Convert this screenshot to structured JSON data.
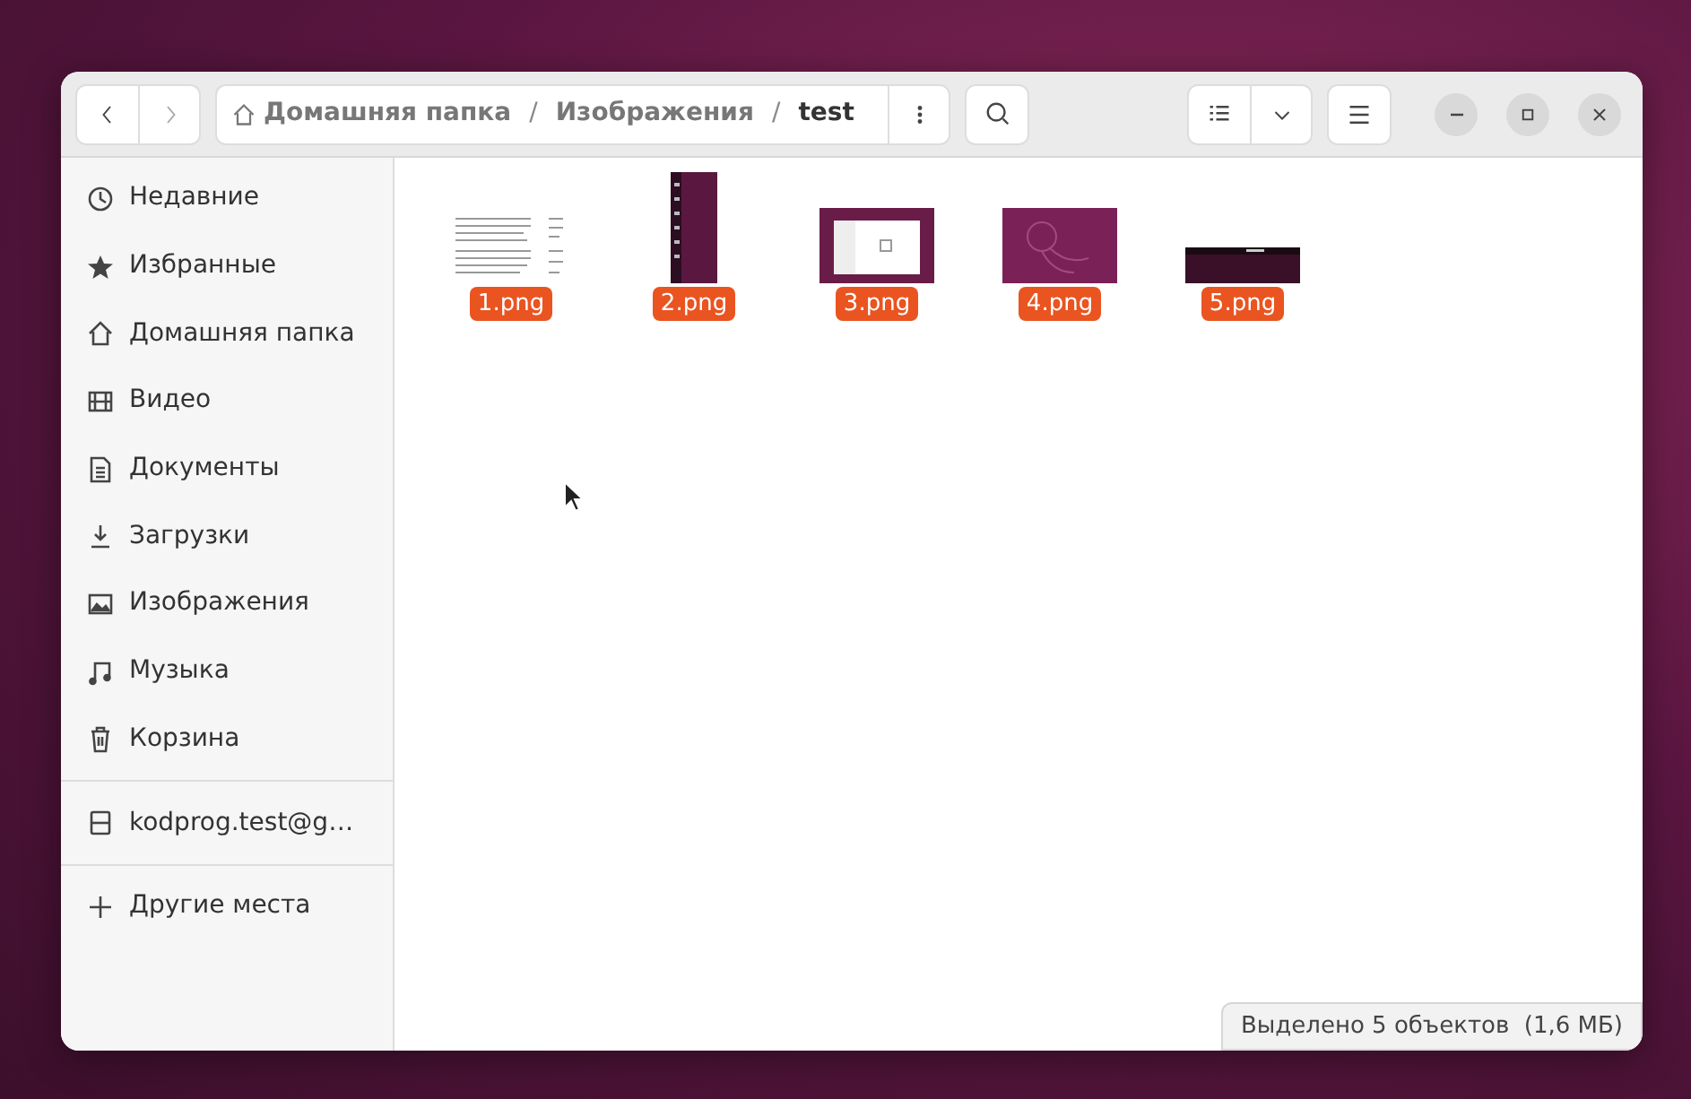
{
  "path_bar": {
    "separators": [
      "/",
      "/"
    ],
    "segments": [
      {
        "label": "Домашняя папка",
        "current": false
      },
      {
        "label": "Изображения",
        "current": false
      },
      {
        "label": "test",
        "current": true
      }
    ]
  },
  "sidebar": {
    "groups": [
      [
        {
          "kind": "recent",
          "label": "Недавние"
        },
        {
          "kind": "starred",
          "label": "Избранные"
        },
        {
          "kind": "home",
          "label": "Домашняя папка"
        },
        {
          "kind": "video",
          "label": "Видео"
        },
        {
          "kind": "documents",
          "label": "Документы"
        },
        {
          "kind": "downloads",
          "label": "Загрузки"
        },
        {
          "kind": "pictures",
          "label": "Изображения"
        },
        {
          "kind": "music",
          "label": "Музыка"
        },
        {
          "kind": "trash",
          "label": "Корзина"
        }
      ],
      [
        {
          "kind": "drive",
          "label": "kodprog.test@g…"
        }
      ],
      [
        {
          "kind": "add",
          "label": "Другие места"
        }
      ]
    ]
  },
  "files": [
    {
      "kind": "document",
      "name": "1.png",
      "selected": true
    },
    {
      "kind": "tall",
      "name": "2.png",
      "selected": true
    },
    {
      "kind": "window",
      "name": "3.png",
      "selected": true
    },
    {
      "kind": "wallpaper",
      "name": "4.png",
      "selected": true
    },
    {
      "kind": "wide",
      "name": "5.png",
      "selected": true
    }
  ],
  "status_bar": {
    "text": "Выделено 5 объектов  (1,6 МБ)"
  }
}
